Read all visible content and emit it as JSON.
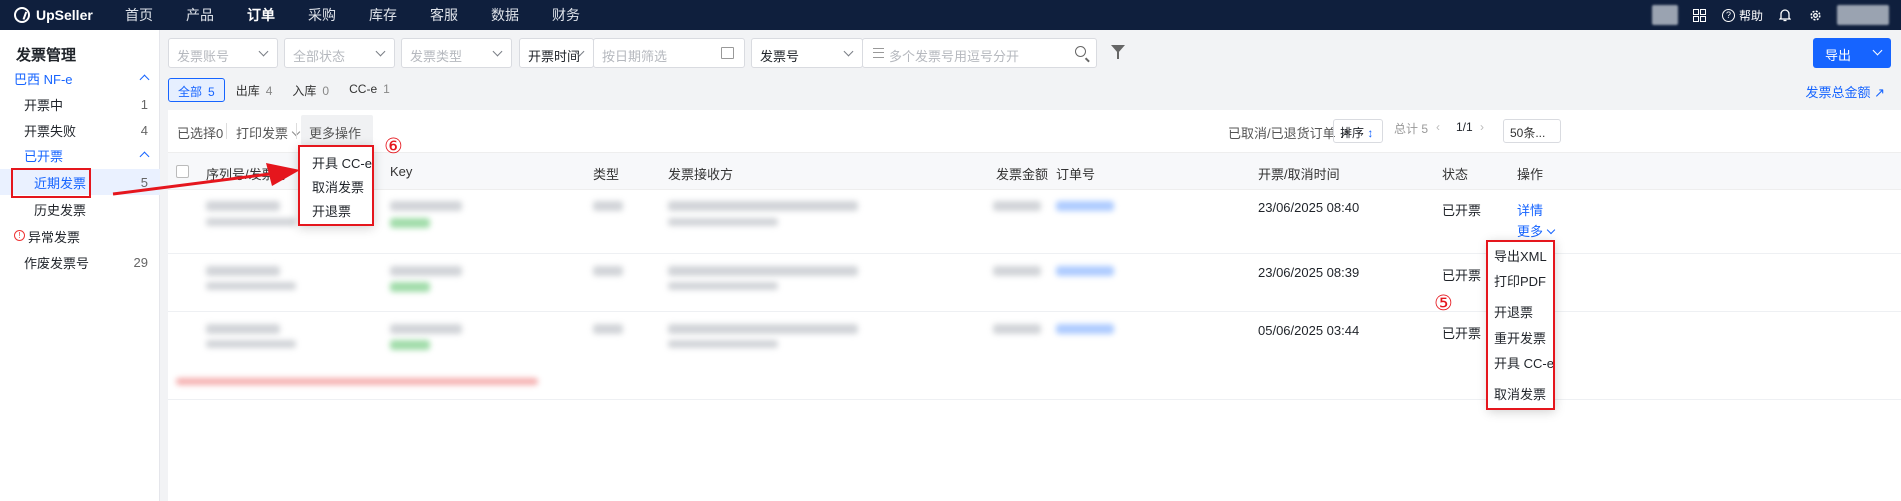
{
  "brand": "UpSeller",
  "nav": [
    "首页",
    "产品",
    "订单",
    "采购",
    "库存",
    "客服",
    "数据",
    "财务"
  ],
  "nav_active": "订单",
  "top_right": {
    "help": "帮助"
  },
  "sidebar": {
    "title": "发票管理",
    "groups": [
      {
        "label": "巴西 NF-e"
      },
      {
        "label": "开票中",
        "count": "1"
      },
      {
        "label": "开票失败",
        "count": "4"
      },
      {
        "label": "已开票"
      },
      {
        "label": "近期发票",
        "count": "5"
      },
      {
        "label": "历史发票"
      },
      {
        "label": "异常发票"
      },
      {
        "label": "作废发票号",
        "count": "29"
      }
    ]
  },
  "filters": {
    "account": "发票账号",
    "status": "全部状态",
    "type": "发票类型",
    "time_field": "开票时间",
    "date_placeholder": "按日期筛选",
    "number_field": "发票号",
    "number_placeholder": "多个发票号用逗号分开",
    "export": "导出"
  },
  "tabs": [
    {
      "label": "全部",
      "count": "5"
    },
    {
      "label": "出库",
      "count": "4"
    },
    {
      "label": "入库",
      "count": "0"
    },
    {
      "label": "CC-e",
      "count": "1"
    }
  ],
  "total_amount_link": "发票总金额",
  "toolbar": {
    "selected": "已选择0",
    "print": "打印发票",
    "more_ops": "更多操作",
    "cancelled_link": "已取消/已退货订单",
    "sort": "排序",
    "total": "总计 5",
    "page": "1/1",
    "page_size": "50条..."
  },
  "more_menu": [
    "开具 CC-e",
    "取消发票",
    "开退票"
  ],
  "columns": {
    "seq": "序列号/发票号",
    "key": "Key",
    "type": "类型",
    "receiver": "发票接收方",
    "amount": "发票金额",
    "order": "订单号",
    "time": "开票/取消时间",
    "status": "状态",
    "action": "操作"
  },
  "rows": [
    {
      "time": "23/06/2025 08:40",
      "status": "已开票",
      "detail": "详情",
      "more": "更多"
    },
    {
      "time": "23/06/2025 08:39",
      "status": "已开票"
    },
    {
      "time": "05/06/2025 03:44",
      "status": "已开票"
    }
  ],
  "row_menu": [
    "导出XML",
    "打印PDF",
    "开退票",
    "重开发票",
    "开具 CC-e",
    "取消发票"
  ],
  "annotations": {
    "five": "⑤",
    "six": "⑥"
  },
  "colors": {
    "accent": "#1664ff",
    "topbar": "#0f1f3d",
    "annotation_red": "#e5161d"
  }
}
